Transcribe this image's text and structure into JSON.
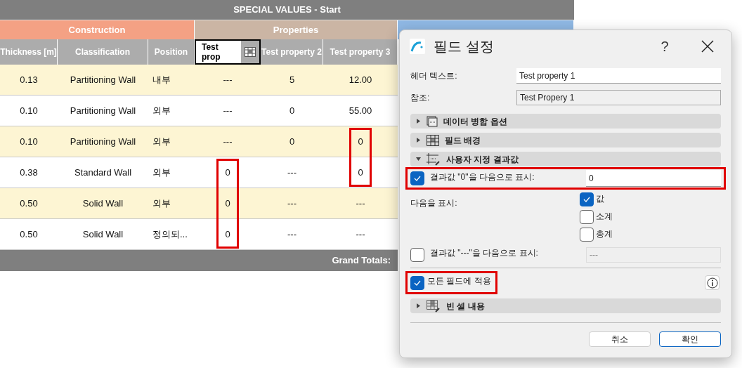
{
  "schedule": {
    "title": "SPECIAL VALUES - Start",
    "groups": [
      {
        "label": "Construction",
        "color": "#f4a184"
      },
      {
        "label": "Properties",
        "color": "#cbb5a4"
      },
      {
        "color": "#8fb8e4"
      }
    ],
    "columns": [
      {
        "label": "Thickness [m]",
        "selected": false
      },
      {
        "label": "Classification",
        "selected": false
      },
      {
        "label": "Position",
        "selected": false
      },
      {
        "label": "Test prop",
        "selected": true
      },
      {
        "label": "Test property 2",
        "selected": false
      },
      {
        "label": "Test property 3",
        "selected": false
      }
    ],
    "rows": [
      [
        {
          "text": "0.13"
        },
        {
          "text": "Partitioning Wall"
        },
        {
          "text": "내부"
        },
        {
          "text": "---"
        },
        {
          "text": "5"
        },
        {
          "text": "12.00"
        }
      ],
      [
        {
          "text": "0.10"
        },
        {
          "text": "Partitioning Wall"
        },
        {
          "text": "외부"
        },
        {
          "text": "---"
        },
        {
          "text": "0"
        },
        {
          "text": "55.00"
        }
      ],
      [
        {
          "text": "0.10"
        },
        {
          "text": "Partitioning Wall"
        },
        {
          "text": "외부"
        },
        {
          "text": "---"
        },
        {
          "text": "0"
        },
        {
          "text": "0",
          "highlighted": true
        }
      ],
      [
        {
          "text": "0.38"
        },
        {
          "text": "Standard Wall"
        },
        {
          "text": "외부"
        },
        {
          "text": "0",
          "highlighted": true
        },
        {
          "text": "---"
        },
        {
          "text": "0",
          "highlighted": true
        }
      ],
      [
        {
          "text": "0.50"
        },
        {
          "text": "Solid Wall"
        },
        {
          "text": "외부"
        },
        {
          "text": "0",
          "highlighted": true
        },
        {
          "text": "---"
        },
        {
          "text": "---"
        }
      ],
      [
        {
          "text": "0.50"
        },
        {
          "text": "Solid Wall"
        },
        {
          "text": "정의되..."
        },
        {
          "text": "0",
          "highlighted": true
        },
        {
          "text": "---"
        },
        {
          "text": "---"
        }
      ]
    ],
    "grand_totals": "Grand Totals:"
  },
  "dialog": {
    "title": "필드 설정",
    "help": "?",
    "header_text": {
      "label": "헤더 텍스트:",
      "value": "Test property 1"
    },
    "reference": {
      "label": "참조:",
      "value": "Test Propery 1"
    },
    "sections_top": [
      {
        "label": "데이터 병합 옵션",
        "expanded": false,
        "kind": "merge"
      },
      {
        "label": "필드 배경",
        "expanded": false,
        "kind": "grid"
      },
      {
        "label": "사용자 지정 결과값",
        "expanded": true,
        "kind": "custom"
      }
    ],
    "zero_result": {
      "label": "결과값 \"0\"을 다음으로 표시:",
      "checked": true,
      "highlighted": true,
      "value": "0"
    },
    "show": {
      "label": "다음을 표시:",
      "options": [
        {
          "label": "값",
          "checked": true
        },
        {
          "label": "소계",
          "checked": false
        },
        {
          "label": "총계",
          "checked": false
        }
      ]
    },
    "dash_result": {
      "label": "결과값 \"---\"을 다음으로 표시:",
      "checked": false,
      "highlighted": false,
      "placeholder": "---"
    },
    "apply_all": {
      "label": "모든 필드에 적용",
      "checked": true,
      "highlighted": true
    },
    "sections_bottom": [
      {
        "label": "빈 셀 내용",
        "expanded": false,
        "kind": "empty"
      }
    ],
    "buttons": [
      {
        "label": "취소",
        "default": false
      },
      {
        "label": "확인",
        "default": true
      }
    ]
  }
}
